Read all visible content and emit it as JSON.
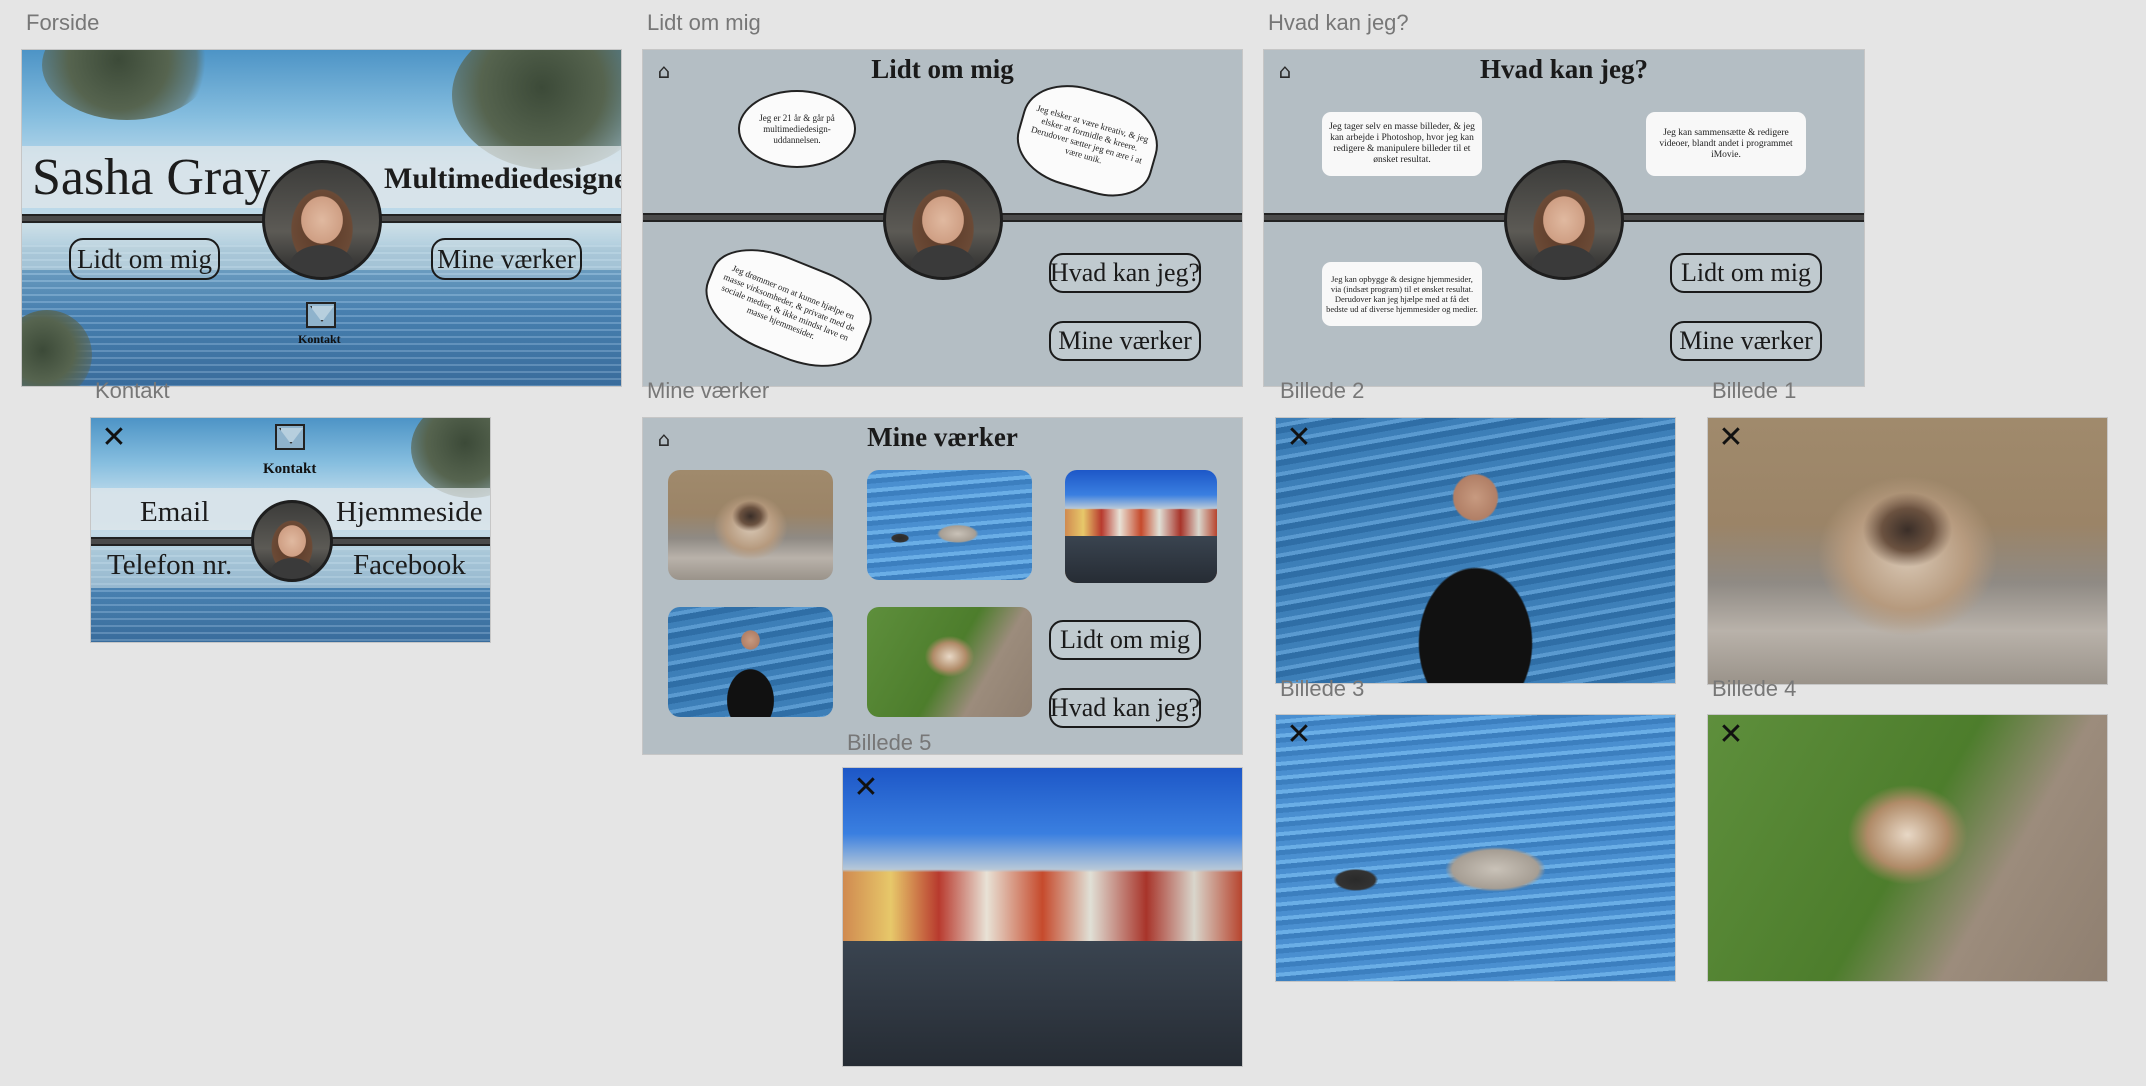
{
  "artboards": {
    "forside": {
      "label": "Forside",
      "name": "Sasha Gray",
      "profession": "Multimediedesigner",
      "btn_about": "Lidt om mig",
      "btn_works": "Mine værker",
      "contact_label": "Kontakt"
    },
    "lidt": {
      "label": "Lidt om mig",
      "title": "Lidt om mig",
      "bubble1": "Jeg er 21 år & går på multimediedesign-uddannelsen.",
      "bubble2": "Jeg elsker at være kreativ, & jeg elsker at formidle & kreere. Derudover sætter jeg en ære i at være unik.",
      "bubble3": "Jeg drømmer om at kunne hjælpe en masse virksomheder, & private med de sociale medier, & ikke mindst lave en masse hjemmesider.",
      "btn_can": "Hvad kan jeg?",
      "btn_works": "Mine værker"
    },
    "hvad": {
      "label": "Hvad kan jeg?",
      "title": "Hvad kan jeg?",
      "box1": "Jeg tager selv en masse billeder, & jeg kan arbejde i Photoshop, hvor jeg kan redigere & manipulere billeder til et ønsket resultat.",
      "box2": "Jeg kan sammensætte & redigere videoer, blandt andet i programmet iMovie.",
      "box3": "Jeg kan opbygge & designe hjemmesider, via (indsæt program) til et ønsket resultat. Derudover kan jeg hjælpe med at få det bedste ud af diverse hjemmesider og medier.",
      "btn_about": "Lidt om mig",
      "btn_works": "Mine værker"
    },
    "kontakt": {
      "label": "Kontakt",
      "contact_label": "Kontakt",
      "email": "Email",
      "website": "Hjemmeside",
      "phone": "Telefon nr.",
      "facebook": "Facebook"
    },
    "vaerker": {
      "label": "Mine værker",
      "title": "Mine værker",
      "btn_about": "Lidt om mig",
      "btn_can": "Hvad kan jeg?"
    },
    "billede1": {
      "label": "Billede 1"
    },
    "billede2": {
      "label": "Billede 2"
    },
    "billede3": {
      "label": "Billede 3"
    },
    "billede4": {
      "label": "Billede 4"
    },
    "billede5": {
      "label": "Billede 5"
    }
  },
  "icons": {
    "home": "home-icon",
    "close": "close-icon",
    "mail": "mail-icon"
  },
  "colors": {
    "canvas": "#e5e5e5",
    "panel_grey": "#b4bec4",
    "bar": "#4a4a4a"
  }
}
